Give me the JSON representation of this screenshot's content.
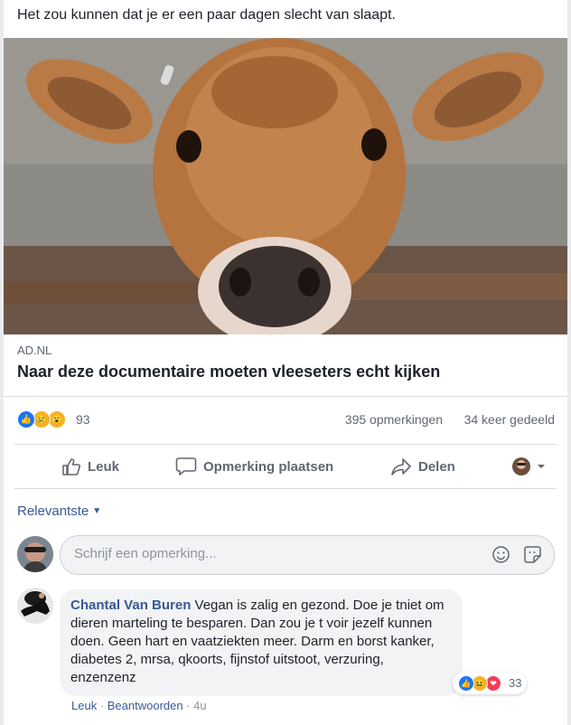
{
  "post": {
    "text": "Het zou kunnen dat je er een paar dagen slecht van slaapt.",
    "link": {
      "domain": "AD.NL",
      "title": "Naar deze documentaire moeten vleeseters echt kijken"
    }
  },
  "stats": {
    "reaction_count": "93",
    "comments": "395 opmerkingen",
    "shares": "34 keer gedeeld"
  },
  "actions": {
    "like": "Leuk",
    "comment": "Opmerking plaatsen",
    "share": "Delen"
  },
  "comments_section": {
    "sort_label": "Relevantste",
    "input_placeholder": "Schrijf een opmerking..."
  },
  "comment": {
    "author": "Chantal Van Buren",
    "text": " Vegan is zalig en gezond. Doe je tniet om dieren marteling te besparen. Dan zou je t voir jezelf kunnen doen. Geen hart en vaatziekten meer. Darm en borst kanker, diabetes 2, mrsa, qkoorts, fijnstof uitstoot, verzuring, enzenzenz",
    "reaction_count": "33",
    "like": "Leuk",
    "reply": "Beantwoorden",
    "sep": " · ",
    "time": "4u"
  },
  "colors": {
    "link_blue": "#385898",
    "like_blue": "#1877f2",
    "love_red": "#f33e58",
    "haha_yellow": "#f7b125"
  }
}
